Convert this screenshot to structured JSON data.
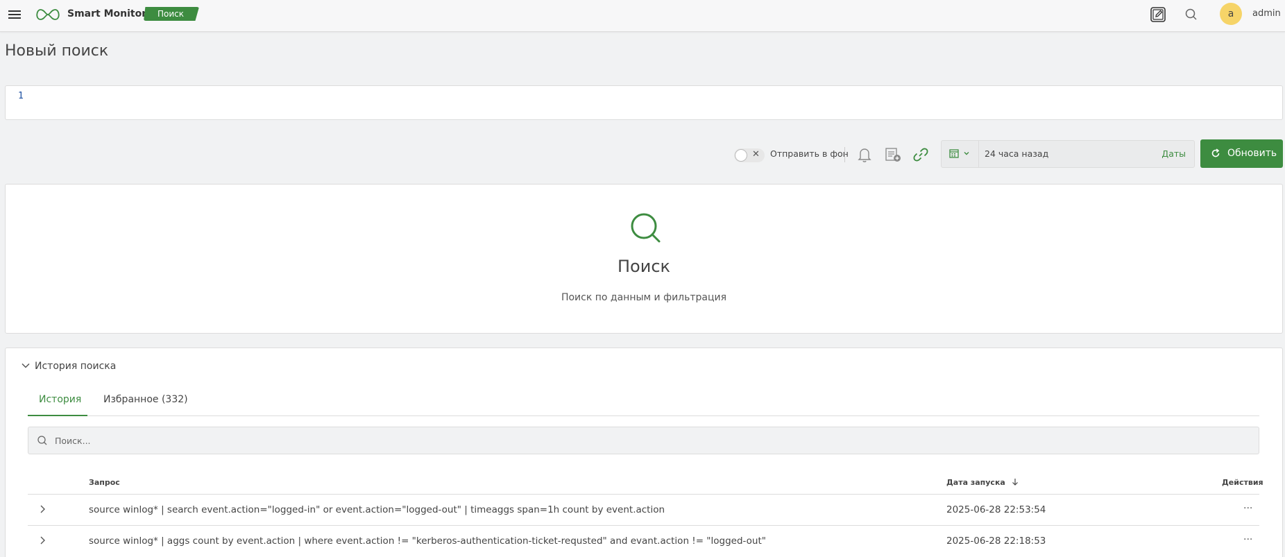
{
  "topbar": {
    "brand": "Smart Monitor",
    "tag": "Поиск",
    "avatar_letter": "a",
    "username": "admin",
    "icons": [
      "menu-icon",
      "logo-icon",
      "edit-icon",
      "search-icon"
    ]
  },
  "page": {
    "title": "Новый поиск"
  },
  "editor": {
    "line_number": "1"
  },
  "toolbar": {
    "background_label": "Отправить в фон",
    "time_range": "24 часа назад",
    "dates_label": "Даты",
    "refresh_label": "Обновить",
    "icons": [
      "bell-icon",
      "report-add-icon",
      "link-icon",
      "calendar-icon"
    ]
  },
  "search_panel": {
    "title": "Поиск",
    "subtitle": "Поиск по данным и фильтрация"
  },
  "history": {
    "header": "История поиска",
    "tabs": [
      {
        "label": "История",
        "active": true
      },
      {
        "label": "Избранное (332)",
        "active": false
      }
    ],
    "search_placeholder": "Поиск...",
    "columns": {
      "query": "Запрос",
      "date": "Дата запуска",
      "actions": "Действия"
    },
    "rows": [
      {
        "query": "source winlog* | search event.action=\"logged-in\" or event.action=\"logged-out\" | timeaggs span=1h count by event.action",
        "date": "2025-06-28 22:53:54",
        "actions": "···"
      },
      {
        "query": "source winlog* | aggs count by event.action | where event.action != \"kerberos-authentication-ticket-requsted\" and evant.action != \"logged-out\"",
        "date": "2025-06-28 22:18:53",
        "actions": "···"
      }
    ]
  },
  "colors": {
    "accent": "#3d8c40",
    "avatar": "#f6d468",
    "background": "#f1f2f3"
  }
}
